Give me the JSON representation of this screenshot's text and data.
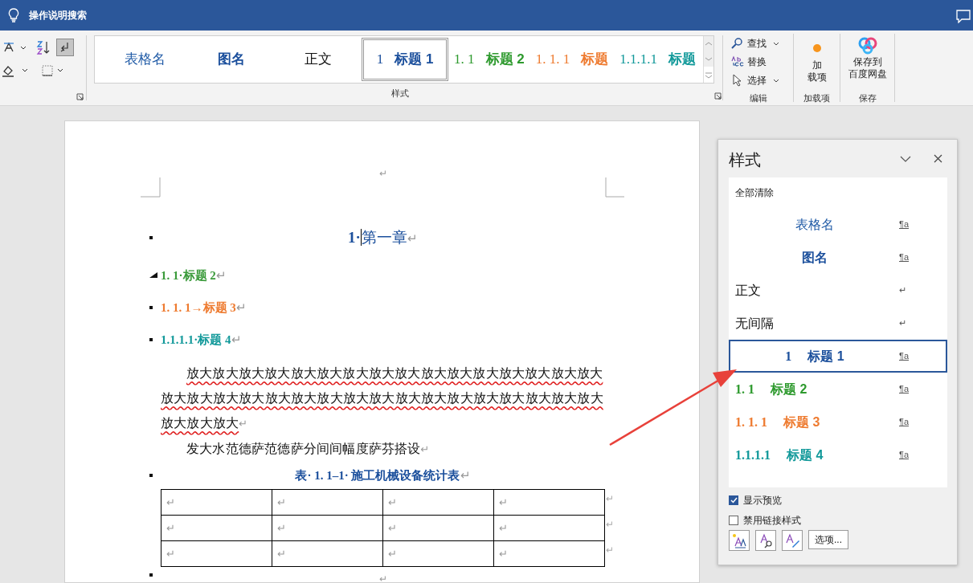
{
  "title_bar": {
    "search_hint": "操作说明搜索"
  },
  "ribbon": {
    "paragraph": {
      "show_marks_pressed": true
    },
    "styles": {
      "label": "样式",
      "items": [
        {
          "label": "表格名",
          "color": "#1f5aa6",
          "bold": false,
          "selected": false
        },
        {
          "label": "图名",
          "color": "#1b4f9c",
          "bold": true,
          "selected": false
        },
        {
          "label": "正文",
          "color": "#111111",
          "bold": false,
          "selected": false
        },
        {
          "number": "1",
          "label": "标题 1",
          "color": "#1b4f9c",
          "bold": true,
          "selected": true
        },
        {
          "number": "1. 1",
          "label": "标题 2",
          "color": "#2e9a2e",
          "bold": true,
          "selected": false
        },
        {
          "number": "1. 1. 1",
          "label": "标题",
          "color": "#ee7b30",
          "bold": true,
          "selected": false
        },
        {
          "number": "1.1.1.1",
          "label": "标题",
          "color": "#12999a",
          "bold": true,
          "selected": false
        }
      ]
    },
    "editing": {
      "label": "编辑",
      "items": [
        {
          "label": "查找",
          "dropdown": true
        },
        {
          "label": "替换",
          "dropdown": false
        },
        {
          "label": "选择",
          "dropdown": true
        }
      ]
    },
    "addins": {
      "button_lines": [
        "加",
        "载项"
      ],
      "label": "加载项"
    },
    "save": {
      "button_lines": [
        "保存到",
        "百度网盘"
      ],
      "label": "保存"
    }
  },
  "document": {
    "paragraphs": [
      {
        "kind": "mark_only",
        "end_mark": "↵"
      },
      {
        "kind": "heading1",
        "text": "1·",
        "text_after_cursor": "第一章",
        "end_mark": "↵",
        "color": "#1b4f9c"
      },
      {
        "kind": "heading2",
        "text": "1. 1·标题 2",
        "end_mark": "↵",
        "color": "#3a9a3a",
        "collapsed": false
      },
      {
        "kind": "heading3",
        "text": "1. 1. 1→标题 3",
        "end_mark": "↵",
        "color": "#ee7b30"
      },
      {
        "kind": "heading4",
        "text": "1.1.1.1·标题 4",
        "end_mark": "↵",
        "color": "#12999a"
      },
      {
        "kind": "body",
        "text": "放大放大放大放大放大放大放大放大放大放大放大放大放大放大放大放大放大放大放大放大放大放大放大放大放大放大放大放大放大放大放大放大放大放大放大放大",
        "end_mark": "↵",
        "misspelled": true
      },
      {
        "kind": "body",
        "text": "发大水范德萨范德萨分间间幅度萨芬搭设",
        "end_mark": "↵",
        "misspelled": false
      },
      {
        "kind": "caption",
        "text": "表· 1. 1–1· 施工机械设备统计表",
        "end_mark": "↵",
        "color": "#1b4f9c"
      },
      {
        "kind": "table",
        "rows": [
          [
            "↵",
            "↵",
            "↵",
            "↵"
          ],
          [
            "↵",
            "↵",
            "↵",
            "↵"
          ],
          [
            "↵",
            "↵",
            "↵",
            "↵"
          ]
        ],
        "row_end_mark": "↵"
      },
      {
        "kind": "empty",
        "end_mark": "↵"
      }
    ]
  },
  "styles_pane": {
    "title": "样式",
    "items": [
      {
        "kind": "clear",
        "label": "全部清除"
      },
      {
        "kind": "centered",
        "label": "表格名",
        "type_mark": "¶a",
        "color": "#1f5aa6",
        "bold": false,
        "selected": false
      },
      {
        "kind": "centered",
        "label": "图名",
        "type_mark": "¶a",
        "color": "#1b4f9c",
        "bold": true,
        "selected": false
      },
      {
        "kind": "left",
        "label": "正文",
        "type_mark": "↵",
        "color": "#111111",
        "bold": false,
        "selected": false
      },
      {
        "kind": "left",
        "label": "无间隔",
        "type_mark": "↵",
        "color": "#111111",
        "bold": false,
        "selected": false
      },
      {
        "kind": "centered",
        "number": "1",
        "label": "标题 1",
        "type_mark": "¶a",
        "color": "#1b4f9c",
        "bold": true,
        "selected": true
      },
      {
        "kind": "left",
        "number": "1. 1",
        "label": "标题 2",
        "type_mark": "¶a",
        "color": "#2e9a2e",
        "bold": true,
        "selected": false
      },
      {
        "kind": "left",
        "number": "1. 1. 1",
        "label": "标题 3",
        "type_mark": "¶a",
        "color": "#ee7b30",
        "bold": true,
        "selected": false
      },
      {
        "kind": "left",
        "number": "1.1.1.1",
        "label": "标题 4",
        "type_mark": "¶a",
        "color": "#12999a",
        "bold": true,
        "selected": false
      }
    ],
    "options": [
      {
        "label": "显示预览",
        "checked": true
      },
      {
        "label": "禁用链接样式",
        "checked": false
      }
    ],
    "options_button": "选项..."
  }
}
